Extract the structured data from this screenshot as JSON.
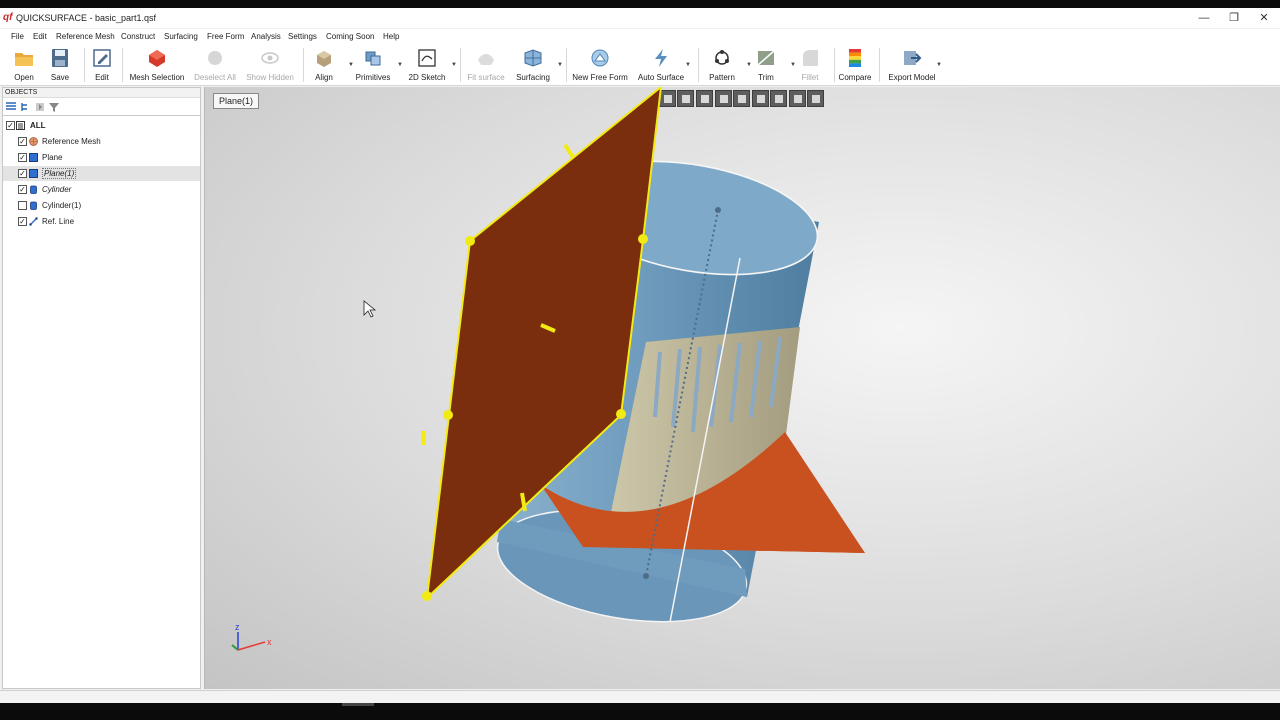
{
  "window": {
    "title": "QUICKSURFACE - basic_part1.qsf",
    "logo_text": "qf",
    "minimize": "—",
    "restore": "❐",
    "close": "✕"
  },
  "menu": [
    "File",
    "Edit",
    "Reference Mesh",
    "Construct",
    "Surfacing",
    "Free Form",
    "Analysis",
    "Settings",
    "Coming Soon",
    "Help"
  ],
  "toolbar": [
    {
      "label": "Open",
      "icon": "folder-icon",
      "enabled": true
    },
    {
      "label": "Save",
      "icon": "save-icon",
      "enabled": true
    },
    {
      "label": "Edit",
      "icon": "edit-icon",
      "enabled": true
    },
    {
      "label": "Mesh Selection",
      "icon": "mesh-selection-icon",
      "enabled": true
    },
    {
      "label": "Deselect All",
      "icon": "deselect-icon",
      "enabled": false
    },
    {
      "label": "Show Hidden",
      "icon": "eye-icon",
      "enabled": false
    },
    {
      "label": "Align",
      "icon": "align-icon",
      "enabled": true
    },
    {
      "label": "Primitives",
      "icon": "primitives-icon",
      "enabled": true
    },
    {
      "label": "2D Sketch",
      "icon": "sketch-icon",
      "enabled": true
    },
    {
      "label": "Fit surface",
      "icon": "fit-surface-icon",
      "enabled": false
    },
    {
      "label": "Surfacing",
      "icon": "surfacing-icon",
      "enabled": true
    },
    {
      "label": "New Free Form",
      "icon": "free-form-icon",
      "enabled": true
    },
    {
      "label": "Auto Surface",
      "icon": "auto-surface-icon",
      "enabled": true
    },
    {
      "label": "Pattern",
      "icon": "pattern-icon",
      "enabled": true
    },
    {
      "label": "Trim",
      "icon": "trim-icon",
      "enabled": true
    },
    {
      "label": "Fillet",
      "icon": "fillet-icon",
      "enabled": false
    },
    {
      "label": "Compare",
      "icon": "compare-icon",
      "enabled": true
    },
    {
      "label": "Export Model",
      "icon": "export-icon",
      "enabled": true
    }
  ],
  "objects_panel": {
    "header": "OBJECTS",
    "items": [
      {
        "label": "ALL",
        "checked": true,
        "bold": true
      },
      {
        "label": "Reference Mesh",
        "checked": true,
        "icon": "mesh-icon"
      },
      {
        "label": "Plane",
        "checked": true,
        "icon": "plane-icon"
      },
      {
        "label": "Plane(1)",
        "checked": true,
        "icon": "plane-icon",
        "selected": true,
        "italic": true
      },
      {
        "label": "Cylinder",
        "checked": true,
        "icon": "cylinder-icon",
        "italic": true
      },
      {
        "label": "Cylinder(1)",
        "checked": false,
        "icon": "cylinder-icon"
      },
      {
        "label": "Ref. Line",
        "checked": true,
        "icon": "ref-line-icon"
      }
    ]
  },
  "viewport": {
    "active_label": "Plane(1)",
    "axes": {
      "x": "x",
      "z": "z"
    },
    "colors": {
      "plane_brown": "#7a2e0d",
      "plane_orange": "#c84f1f",
      "cylinder_blue": "#7aa6c4",
      "mesh_beige": "#c8c0a4",
      "handle_yellow": "#f2ea13"
    }
  }
}
